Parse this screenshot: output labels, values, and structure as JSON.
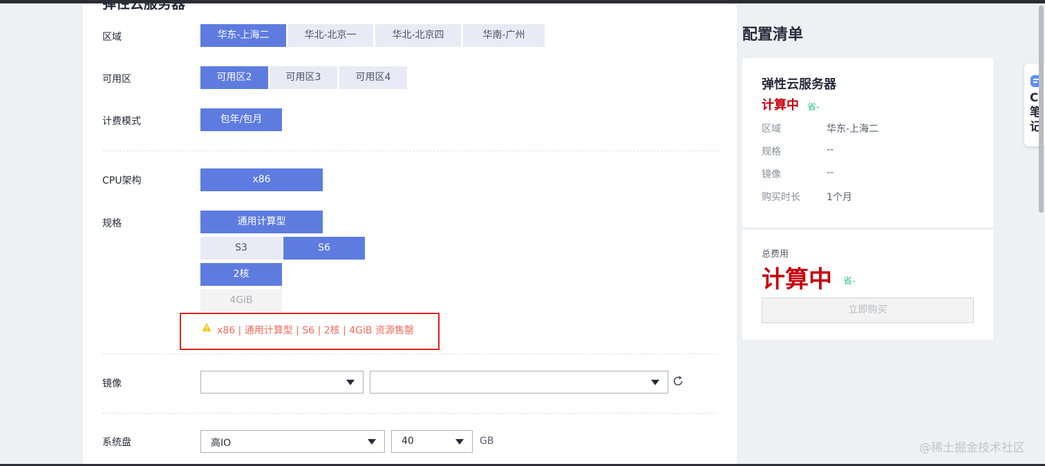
{
  "section": {
    "title": "弹性云服务器"
  },
  "region": {
    "label": "区域",
    "options": [
      "华东-上海二",
      "华北-北京一",
      "华北-北京四",
      "华南-广州"
    ]
  },
  "zone": {
    "label": "可用区",
    "options": [
      "可用区2",
      "可用区3",
      "可用区4"
    ]
  },
  "billing": {
    "label": "计费模式",
    "options": [
      "包年/包月"
    ]
  },
  "cpu": {
    "label": "CPU架构",
    "options": [
      "x86"
    ]
  },
  "spec": {
    "label": "规格",
    "type_option": "通用计算型",
    "series_options": [
      "S3",
      "S6"
    ],
    "core_option": "2核",
    "memory_option": "4GiB",
    "warning": "x86 | 通用计算型 | S6 | 2核 | 4GiB 资源售罄"
  },
  "image": {
    "label": "镜像",
    "select1": "",
    "select2": ""
  },
  "disk": {
    "label": "系统盘",
    "type": "高IO",
    "size": "40",
    "unit": "GB"
  },
  "config": {
    "title": "配置清单",
    "product": "弹性云服务器",
    "price": "计算中",
    "save": "省-",
    "rows": [
      {
        "key": "区域",
        "value": "华东-上海二"
      },
      {
        "key": "规格",
        "value": "--"
      },
      {
        "key": "镜像",
        "value": "--"
      },
      {
        "key": "购买时长",
        "value": "1个月"
      }
    ],
    "total_label": "总费用",
    "total_price": "计算中",
    "total_save": "省-",
    "buy_button": "立即购买"
  },
  "float_widget": {
    "text": "C笔记"
  },
  "watermark": "@稀土掘金技术社区",
  "colors": {
    "accent": "#5e7ce0",
    "price_red": "#c7000b",
    "save_green": "#3ac295",
    "warning": "#f06b5b",
    "highlight_box": "#e0201e"
  }
}
